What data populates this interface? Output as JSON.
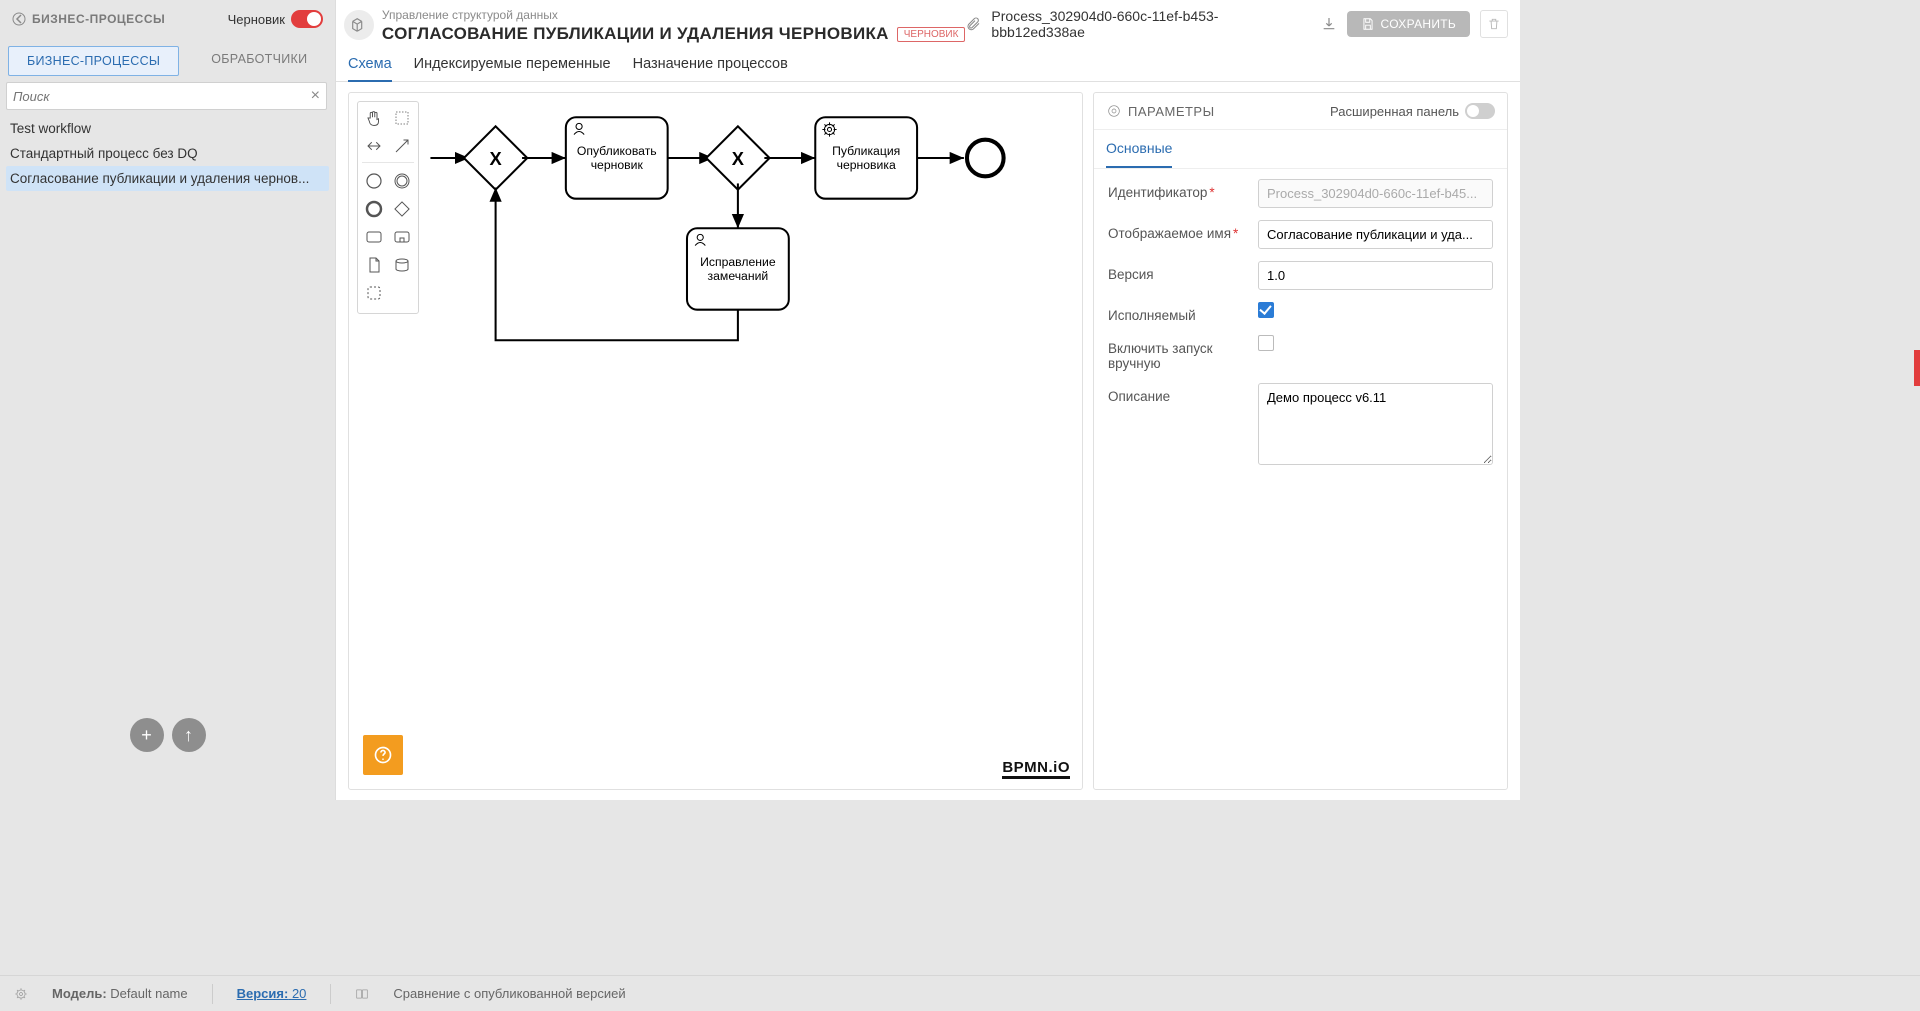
{
  "sidebar": {
    "title": "БИЗНЕС-ПРОЦЕССЫ",
    "draft_label": "Черновик",
    "tabs": [
      "БИЗНЕС-ПРОЦЕССЫ",
      "ОБРАБОТЧИКИ"
    ],
    "search_placeholder": "Поиск",
    "items": [
      "Test workflow",
      "Стандартный процесс без DQ",
      "Согласование публикации и удаления чернов..."
    ]
  },
  "header": {
    "breadcrumb": "Управление структурой данных",
    "title": "СОГЛАСОВАНИЕ ПУБЛИКАЦИИ И УДАЛЕНИЯ ЧЕРНОВИКА",
    "badge": "ЧЕРНОВИК",
    "process_id": "Process_302904d0-660c-11ef-b453-bbb12ed338ae",
    "save": "СОХРАНИТЬ"
  },
  "main_tabs": [
    "Схема",
    "Индексируемые переменные",
    "Назначение процессов"
  ],
  "diagram": {
    "task1": "Опубликовать",
    "task1b": "черновик",
    "task2": "Публикация",
    "task2b": "черновика",
    "task3": "Исправление",
    "task3b": "замечаний"
  },
  "props": {
    "panel_title": "ПАРАМЕТРЫ",
    "ext_label": "Расширенная панель",
    "tab": "Основные",
    "fields": {
      "id_label": "Идентификатор",
      "id_value": "Process_302904d0-660c-11ef-b45...",
      "name_label": "Отображаемое имя",
      "name_value": "Согласование публикации и уда...",
      "ver_label": "Версия",
      "ver_value": "1.0",
      "exec_label": "Исполняемый",
      "manual_label": "Включить запуск вручную",
      "desc_label": "Описание",
      "desc_value": "Демо процесс v6.11"
    }
  },
  "status": {
    "model_label": "Модель:",
    "model_value": "Default name",
    "version_label": "Версия:",
    "version_value": "20",
    "compare": "Сравнение с опубликованной версией"
  },
  "bpmn": "BPMN.iO"
}
